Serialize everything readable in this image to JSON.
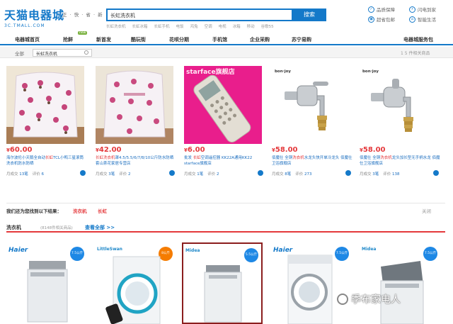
{
  "header": {
    "logo_main": "天猫电器城",
    "logo_sub": "3C.TMALL.COM",
    "slogan": "正 · 快 · 省 · 新",
    "search_value": "长虹洗衣机",
    "search_button": "搜索",
    "hotwords": [
      "长虹洗衣机",
      "长虹冰箱",
      "长虹手机",
      "电饭",
      "鸿兔",
      "空调",
      "电视",
      "冰箱",
      "移动",
      "谷歌55"
    ],
    "services": [
      {
        "label": "品质保障",
        "icon": "shield-icon"
      },
      {
        "label": "闪电到家",
        "icon": "lightning-icon"
      },
      {
        "label": "超省包邮",
        "icon": "truck-icon"
      },
      {
        "label": "智能生活",
        "icon": "home-icon"
      }
    ]
  },
  "nav": {
    "items": [
      "电器城首页",
      "抢鲜",
      "新首发",
      "酷玩街",
      "花呗分期",
      "手机馆",
      "企业采购",
      "苏宁易购"
    ],
    "new_badge": "new",
    "right_link": "电器城服务包"
  },
  "breadcrumb": {
    "all": "全部",
    "value": "长虹洗衣机",
    "page": "1   5 件相关商品"
  },
  "products": [
    {
      "price": "60.00",
      "title_pre": "海尔波伦小天鹅全自动",
      "title_hl": "长虹",
      "title_post": "TCL小鸭三星滚筒洗衣机防水防晒",
      "sales_label": "月成交",
      "sales": "13笔",
      "review_label": "评价",
      "reviews": "6"
    },
    {
      "price": "42.00",
      "title_pre": "",
      "title_hl": "长虹洗衣机",
      "title_post": "罩4.5/5.5/6/7/8/10公斤防水防晒套山茶花家居专营店",
      "sales_label": "月成交",
      "sales": "3笔",
      "review_label": "评价",
      "reviews": "2"
    },
    {
      "price": "6.00",
      "title_pre": "批发 ",
      "title_hl": "长虹",
      "title_post": "空调遥控器 KK22A通用KK22 starface旗舰店",
      "sales_label": "月成交",
      "sales": "1笔",
      "review_label": "评价",
      "reviews": "2"
    },
    {
      "price": "58.00",
      "title_pre": "佰魔仕 全铜",
      "title_hl": "洗衣机",
      "title_post": "水龙头快开单冷龙头 佰魔仕卫浴旗舰店",
      "sales_label": "月成交",
      "sales": "8笔",
      "review_label": "评价",
      "reviews": "273"
    },
    {
      "price": "58.00",
      "title_pre": "佰魔仕 全铜",
      "title_hl": "洗衣机",
      "title_post": "龙头加长型无手柄水龙 佰魔仕卫浴旗舰店",
      "sales_label": "月成交",
      "sales": "3笔",
      "review_label": "评价",
      "reviews": "138"
    }
  ],
  "watermark_text": "starface旗舰店",
  "related": {
    "text": "我们还为您找到以下结果：",
    "links": [
      "洗衣机",
      "长虹"
    ],
    "close": "关闭"
  },
  "section": {
    "keyword": "洗衣机",
    "count": "(8148件相关商品)",
    "see_all": "查看全部 >>"
  },
  "washers": [
    {
      "brand": "Haier",
      "badge": "7.5公斤"
    },
    {
      "brand": "LittleSwan",
      "badge": "8公斤"
    },
    {
      "brand": "Midea",
      "badge": "5.5公斤"
    },
    {
      "brand": "Haier",
      "badge": "7.5公斤"
    },
    {
      "brand": "Midea",
      "badge": "7.5公斤"
    }
  ],
  "wechat_watermark": "季布家电人",
  "colors": {
    "brand_blue": "#1479c9",
    "price_red": "#e4393c"
  }
}
